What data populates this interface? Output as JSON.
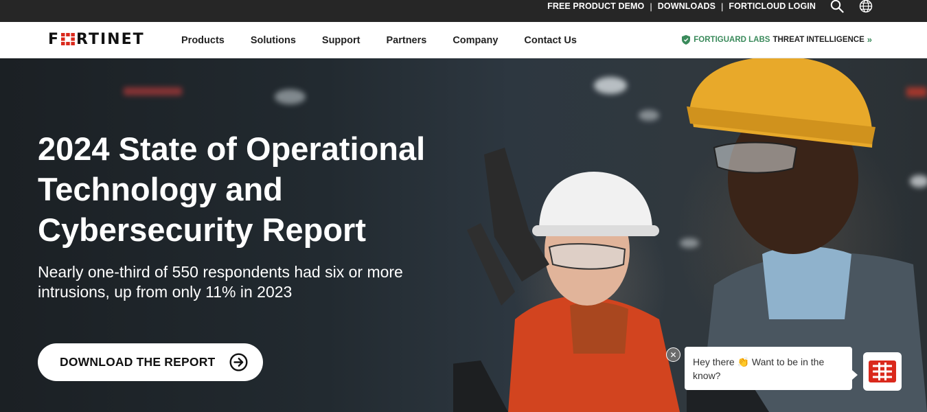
{
  "topbar": {
    "links": [
      "FREE PRODUCT DEMO",
      "DOWNLOADS",
      "FORTICLOUD LOGIN"
    ],
    "separator": "|",
    "icons": [
      "search-icon",
      "globe-icon"
    ]
  },
  "nav": {
    "logo_text_left": "F",
    "logo_text_right": "RTINET",
    "items": [
      "Products",
      "Solutions",
      "Support",
      "Partners",
      "Company",
      "Contact Us"
    ],
    "fortiguard": {
      "green_label": "FORTIGUARD LABS",
      "dark_label": "THREAT INTELLIGENCE",
      "arrow": "»"
    }
  },
  "hero": {
    "title": "2024 State of Operational Technology and Cybersecurity Report",
    "subtitle": "Nearly one-third of 550 respondents had six or more intrusions, up from only 11% in 2023",
    "cta_label": "DOWNLOAD THE REPORT"
  },
  "chat": {
    "close_glyph": "✕",
    "message": "Hey there 👏 Want to be in the know?"
  },
  "colors": {
    "brand_red": "#da291c",
    "fortiguard_green": "#3a8a5b",
    "topbar_bg": "#262626"
  }
}
